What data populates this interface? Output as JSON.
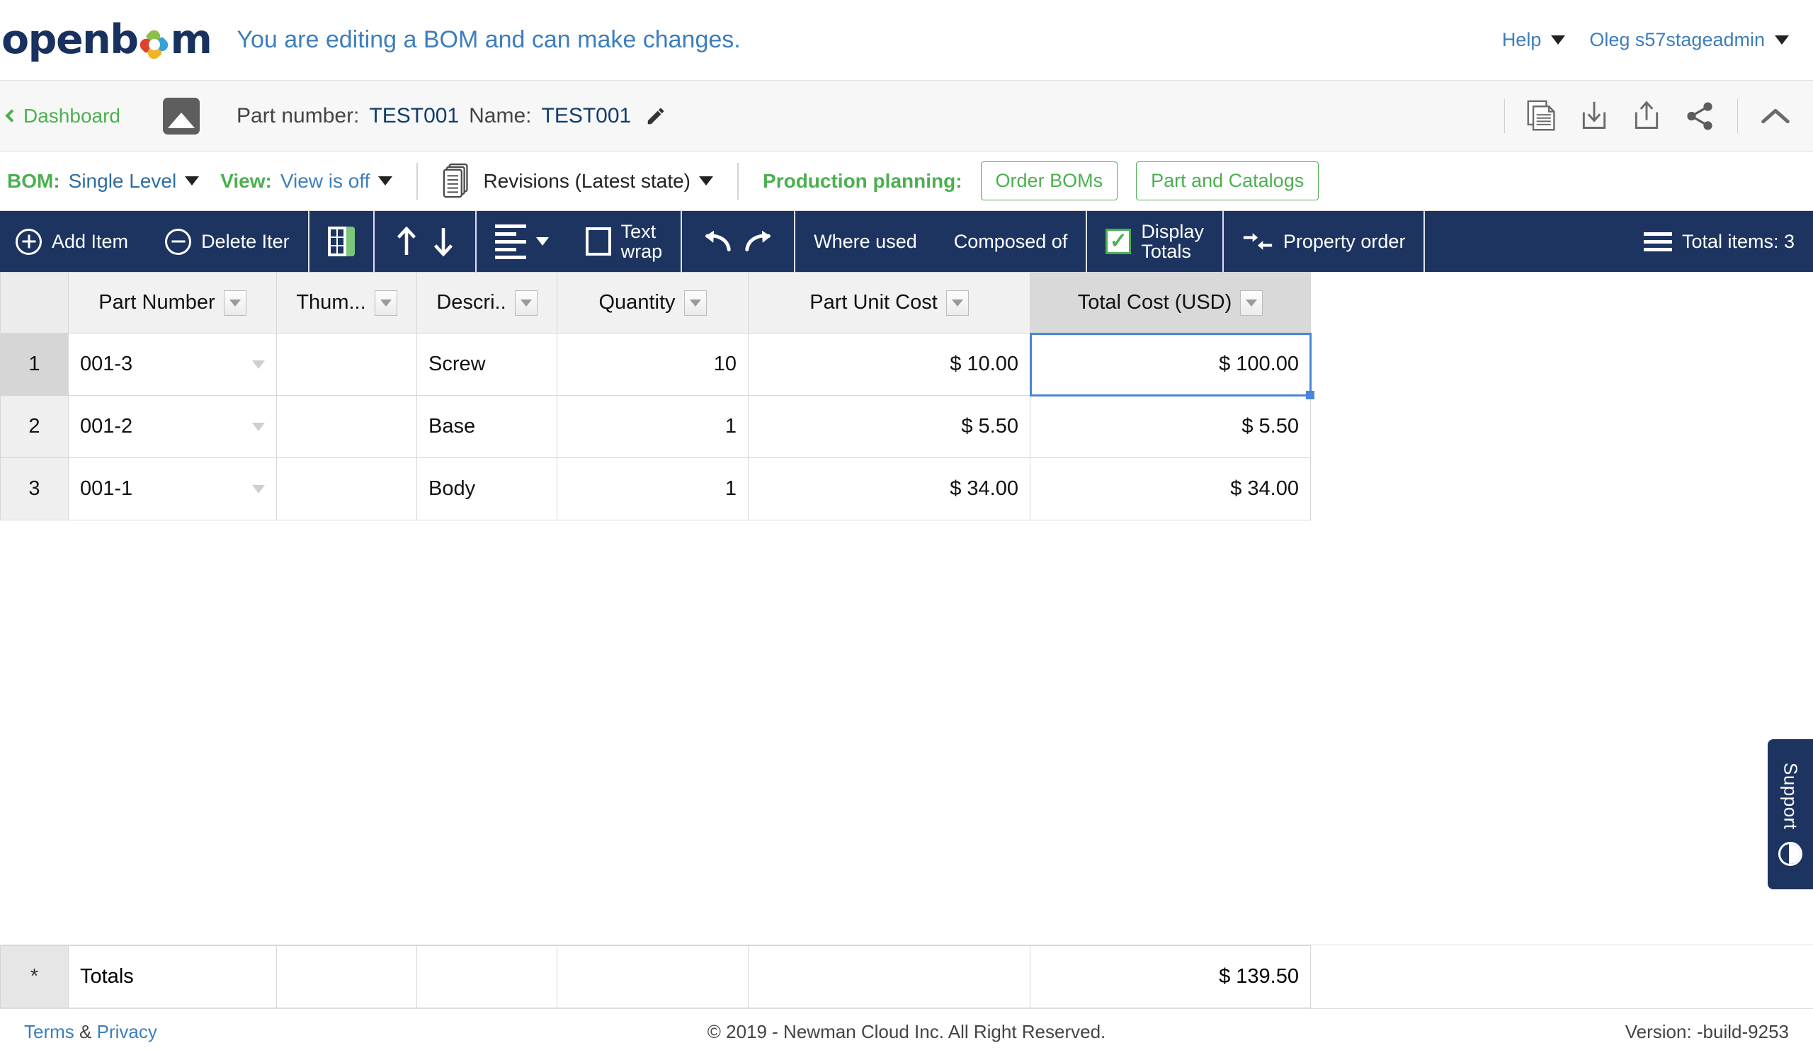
{
  "header": {
    "logo_text_1": "openb",
    "logo_text_2": "m",
    "edit_message": "You are editing a BOM and can make changes.",
    "help_label": "Help",
    "user_label": "Oleg s57stageadmin"
  },
  "breadcrumb": {
    "dashboard_label": "Dashboard",
    "part_number_label": "Part number:",
    "part_number_value": "TEST001",
    "name_label": "Name:",
    "name_value": "TEST001",
    "icons": {
      "thumbnail": "image-thumbnail-icon",
      "edit": "pencil-icon",
      "copy": "copy-document-icon",
      "download": "download-icon",
      "upload": "upload-icon",
      "share": "share-icon",
      "collapse": "chevron-up-icon"
    }
  },
  "bombar": {
    "bom_label": "BOM:",
    "bom_value": "Single Level",
    "view_label": "View:",
    "view_value": "View is off",
    "revisions_label": "Revisions (Latest state)",
    "production_planning_label": "Production planning:",
    "order_boms_button": "Order BOMs",
    "part_catalogs_button": "Part and Catalogs",
    "accent_green": "#4caf50",
    "accent_blue": "#3d7ebd"
  },
  "toolbar": {
    "add_item": "Add Item",
    "delete_item": "Delete Iter",
    "text_wrap_line1": "Text",
    "text_wrap_line2": "wrap",
    "where_used": "Where used",
    "composed_of": "Composed of",
    "display_totals_line1": "Display",
    "display_totals_line2": "Totals",
    "property_order": "Property order",
    "total_items": "Total items: 3",
    "background": "#1d3461"
  },
  "table": {
    "columns": [
      {
        "key": "rownum",
        "label": "",
        "filter": false,
        "align": "center"
      },
      {
        "key": "part_number",
        "label": "Part Number",
        "filter": true,
        "align": "left"
      },
      {
        "key": "thumbnail",
        "label": "Thum...",
        "filter": true,
        "align": "left"
      },
      {
        "key": "description",
        "label": "Descri..",
        "filter": true,
        "align": "left"
      },
      {
        "key": "quantity",
        "label": "Quantity",
        "filter": true,
        "align": "right"
      },
      {
        "key": "part_unit_cost",
        "label": "Part Unit Cost",
        "filter": true,
        "align": "right"
      },
      {
        "key": "total_cost",
        "label": "Total Cost (USD)",
        "filter": true,
        "align": "right"
      }
    ],
    "selected_column": "total_cost",
    "selected_cell": {
      "row": 0,
      "column": "total_cost"
    },
    "rows": [
      {
        "rownum": "1",
        "part_number": "001-3",
        "thumbnail": "",
        "description": "Screw",
        "quantity": "10",
        "part_unit_cost": "$ 10.00",
        "total_cost": "$ 100.00"
      },
      {
        "rownum": "2",
        "part_number": "001-2",
        "thumbnail": "",
        "description": "Base",
        "quantity": "1",
        "part_unit_cost": "$ 5.50",
        "total_cost": "$ 5.50"
      },
      {
        "rownum": "3",
        "part_number": "001-1",
        "thumbnail": "",
        "description": "Body",
        "quantity": "1",
        "part_unit_cost": "$ 34.00",
        "total_cost": "$ 34.00"
      }
    ],
    "totals_row": {
      "rownum": "*",
      "part_number": "Totals",
      "thumbnail": "",
      "description": "",
      "quantity": "",
      "part_unit_cost": "",
      "total_cost": "$ 139.50"
    }
  },
  "support": {
    "label": "Support"
  },
  "footer": {
    "terms": "Terms",
    "amp": " & ",
    "privacy": "Privacy",
    "copyright": "© 2019 - Newman Cloud Inc. All Right Reserved.",
    "version": "Version: -build-9253"
  }
}
